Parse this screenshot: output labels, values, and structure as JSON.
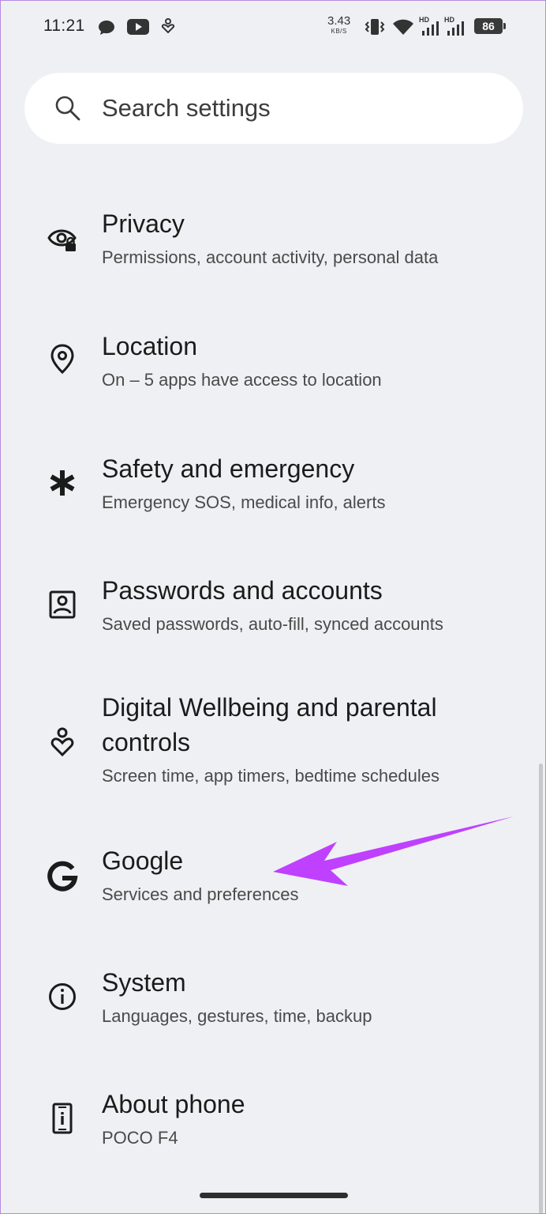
{
  "status_bar": {
    "time": "11:21",
    "net_speed": "3.43",
    "net_unit": "KB/S",
    "battery": "86",
    "icons": [
      "chat-bubble-icon",
      "youtube-icon",
      "digital-wellbeing-icon",
      "vibrate-icon",
      "wifi-icon",
      "hd-signal-icon",
      "hd-signal-icon"
    ]
  },
  "search": {
    "placeholder": "Search settings"
  },
  "settings": [
    {
      "title": "Privacy",
      "subtitle": "Permissions, account activity, personal data",
      "icon": "privacy-eye-lock-icon"
    },
    {
      "title": "Location",
      "subtitle": "On – 5 apps have access to location",
      "icon": "location-pin-icon"
    },
    {
      "title": "Safety and emergency",
      "subtitle": "Emergency SOS, medical info, alerts",
      "icon": "asterisk-icon"
    },
    {
      "title": "Passwords and accounts",
      "subtitle": "Saved passwords, auto-fill, synced accounts",
      "icon": "account-box-icon"
    },
    {
      "title_line1": "Digital Wellbeing and parental",
      "title_line2": "controls",
      "subtitle": "Screen time, app timers, bedtime schedules",
      "icon": "wellbeing-heart-icon"
    },
    {
      "title": "Google",
      "subtitle": "Services and preferences",
      "icon": "google-g-icon"
    },
    {
      "title": "System",
      "subtitle": "Languages, gestures, time, backup",
      "icon": "info-circle-icon"
    },
    {
      "title": "About phone",
      "subtitle": "POCO F4",
      "icon": "phone-info-icon"
    }
  ],
  "colors": {
    "background": "#eff0f3",
    "annotation_arrow": "#bf40ff"
  }
}
